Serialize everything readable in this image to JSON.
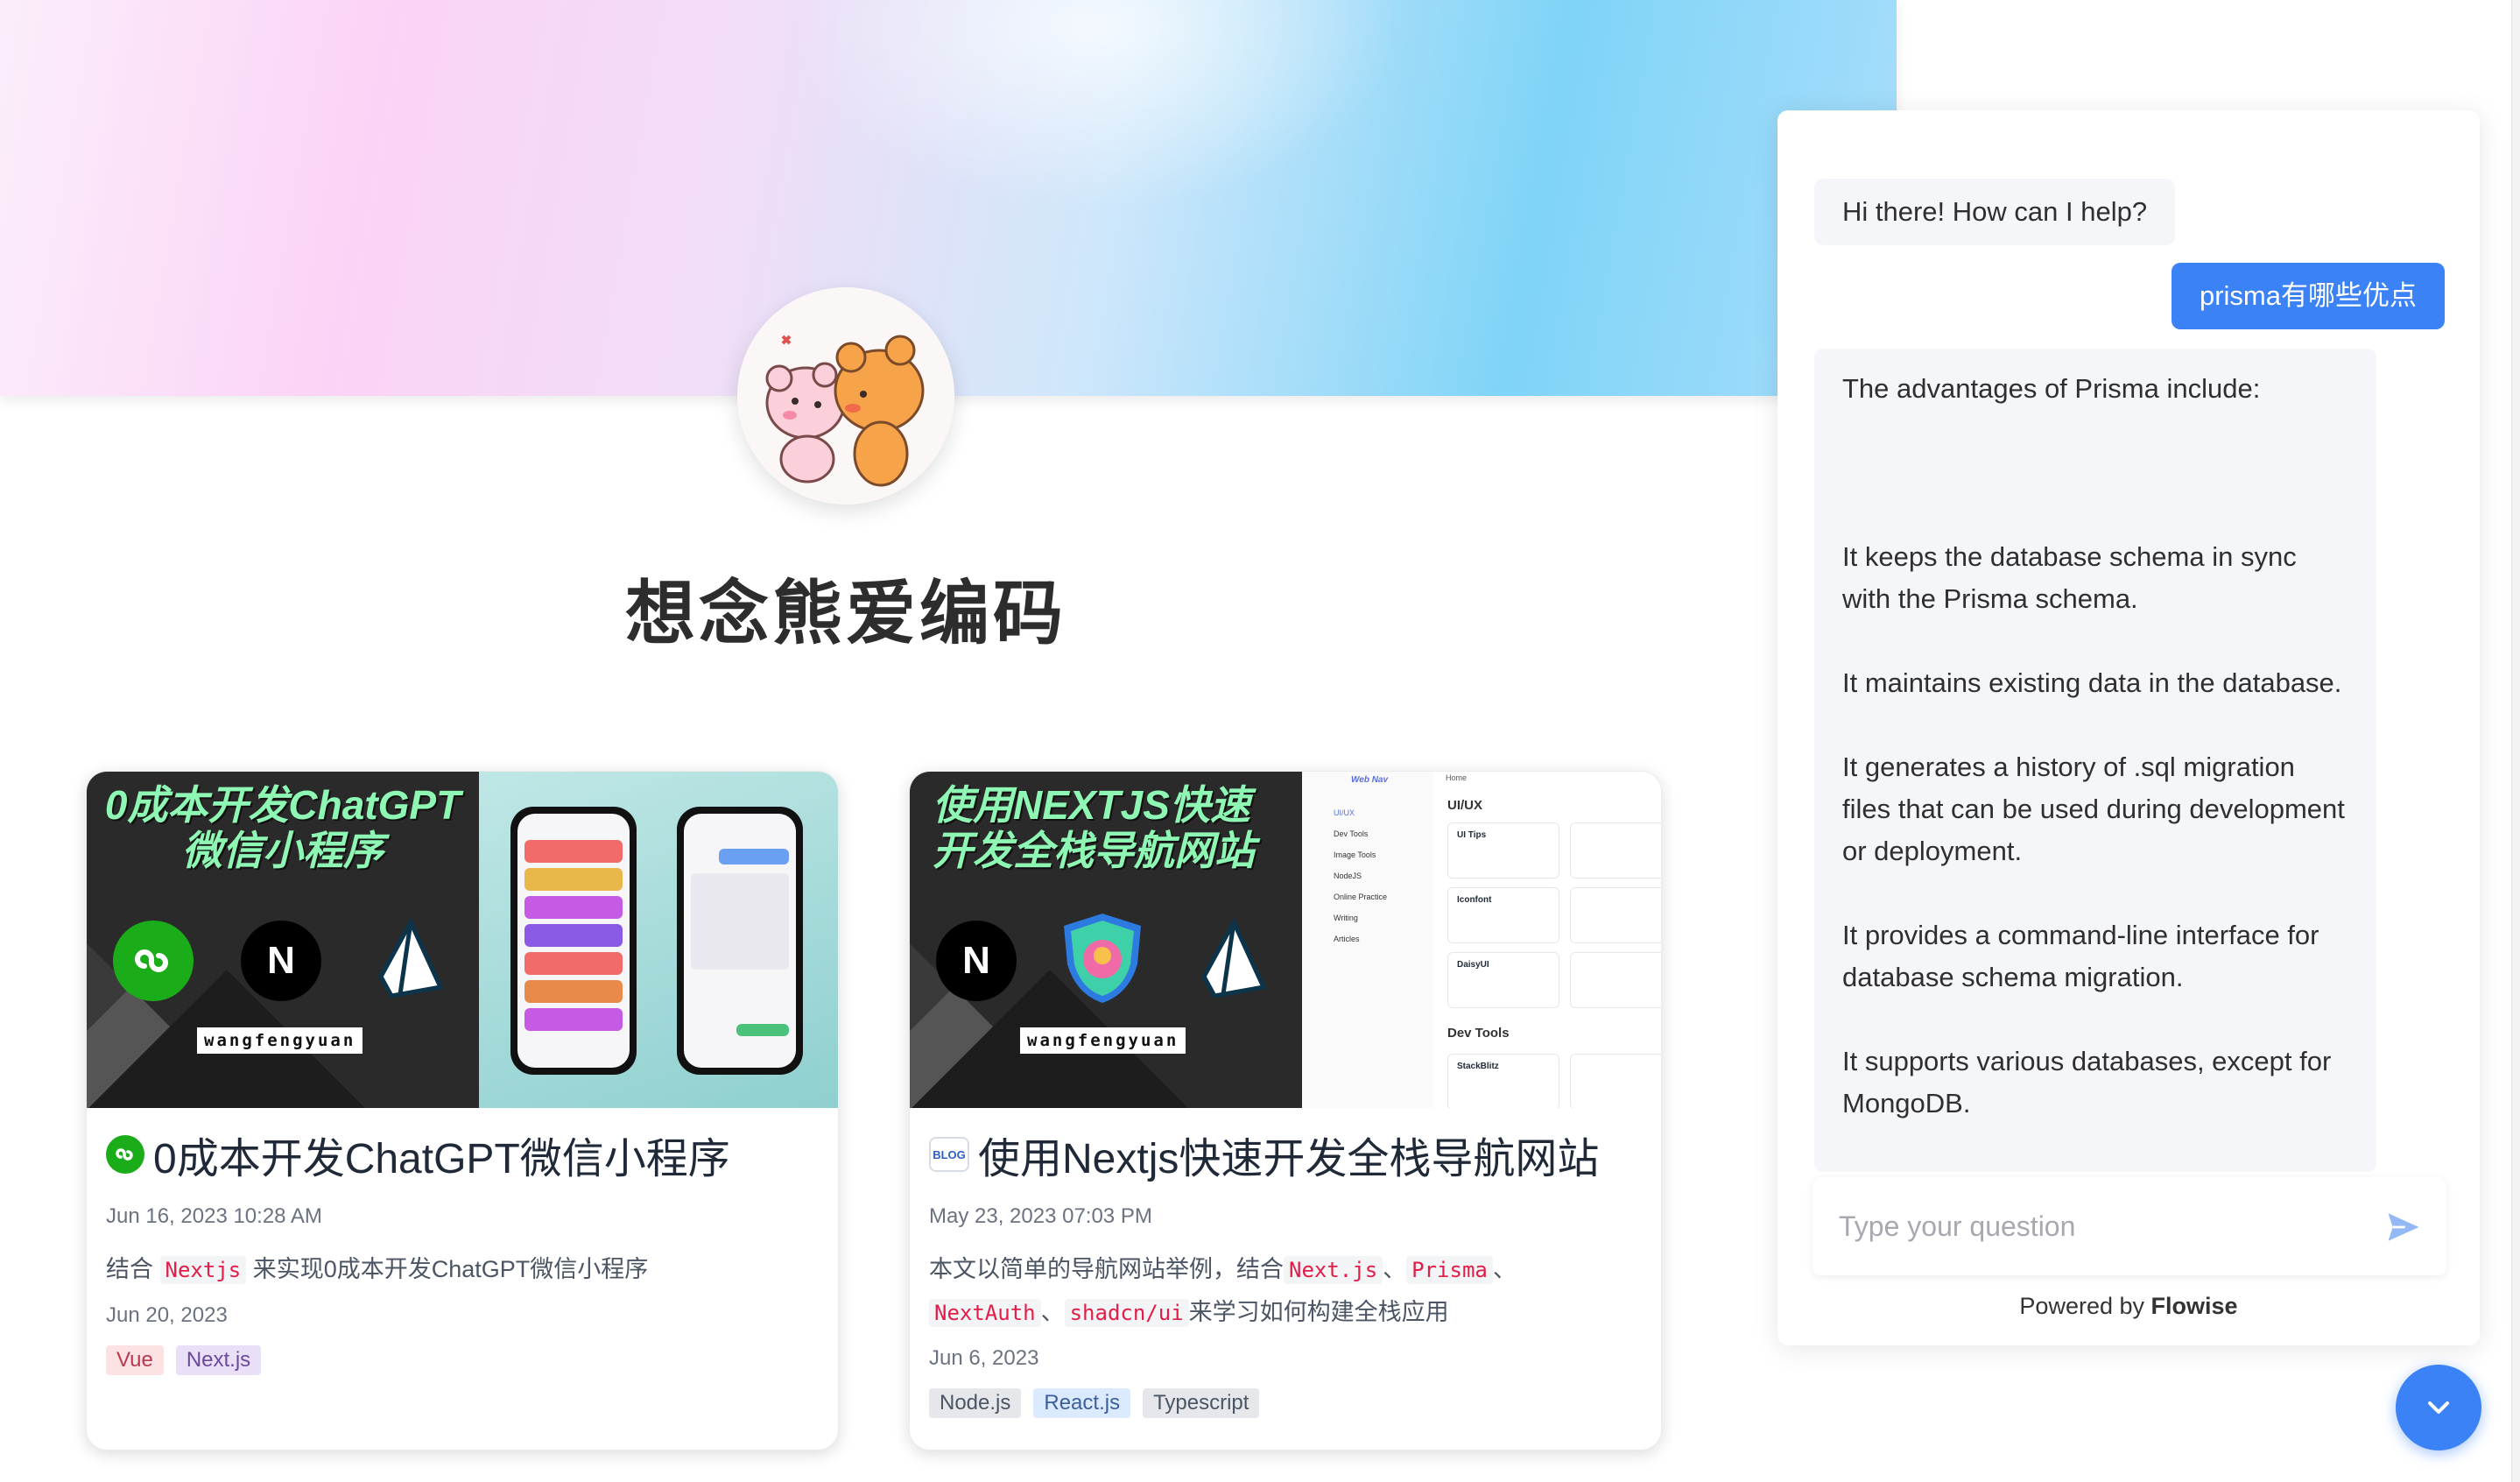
{
  "site": {
    "title": "想念熊爱编码"
  },
  "posts": [
    {
      "cover_title": "0成本开发ChatGPT微信小程序",
      "cover_author": "wangfengyuan",
      "cover_logo_n": "N",
      "title": "0成本开发ChatGPT微信小程序",
      "published": "Jun 16, 2023 10:28 AM",
      "desc_prefix": "结合",
      "desc_code_1": "Nextjs",
      "desc_suffix": "来实现0成本开发ChatGPT微信小程序",
      "updated": "Jun 20, 2023",
      "tags": [
        "Vue",
        "Next.js"
      ]
    },
    {
      "cover_title": "使用NEXTJS快速开发全栈导航网站",
      "cover_author": "wangfengyuan",
      "cover_logo_n": "N",
      "cover_shot_brand": "Web Nav",
      "cover_shot_home": "Home",
      "cover_shot_section_1": "UI/UX",
      "cover_shot_section_2": "Dev Tools",
      "cover_shot_menu": [
        "UI/UX",
        "Dev Tools",
        "Image Tools",
        "NodeJS",
        "Online Practice",
        "Writing",
        "Articles"
      ],
      "cover_shot_cards": [
        "UI Tips",
        "Iconfont",
        "DaisyUI",
        "StackBlitz"
      ],
      "title_icon_label": "BLOG",
      "title": "使用Nextjs快速开发全栈导航网站",
      "published": "May 23, 2023 07:03 PM",
      "desc_prefix": "本文以简单的导航网站举例，结合",
      "desc_code_1": "Next.js",
      "desc_sep_1": "、",
      "desc_code_2": "Prisma",
      "desc_sep_2": "、",
      "desc_code_3": "NextAuth",
      "desc_sep_3": "、",
      "desc_code_4": "shadcn/ui",
      "desc_suffix": "来学习如何构建全栈应用",
      "updated": "Jun 6, 2023",
      "tags": [
        "Node.js",
        "React.js",
        "Typescript"
      ]
    }
  ],
  "chat": {
    "messages": [
      {
        "role": "bot",
        "text": "Hi there! How can I help?"
      },
      {
        "role": "user",
        "text": "prisma有哪些优点"
      },
      {
        "role": "bot",
        "paragraphs": [
          "The advantages of Prisma include:",
          "It keeps the database schema in sync with the Prisma schema.",
          "It maintains existing data in the database.",
          "It generates a history of .sql migration files that can be used during development or deployment.",
          "It provides a command-line interface for database schema migration.",
          "It supports various databases, except for MongoDB."
        ]
      }
    ],
    "input_placeholder": "Type your question",
    "powered_prefix": "Powered by",
    "powered_brand": "Flowise"
  },
  "colors": {
    "accent": "#3b82f6",
    "code_text": "#e11d48",
    "tag_vue_bg": "#fde2e4",
    "tag_next_bg": "#e9dff7",
    "tag_node_bg": "#e5e7eb",
    "tag_react_bg": "#dbeafe",
    "tag_ts_bg": "#e5e7eb"
  },
  "icons": {
    "send": "send-icon",
    "fab": "chevron-down-icon",
    "post1": "mini-program-icon",
    "post2": "blog-icon"
  }
}
